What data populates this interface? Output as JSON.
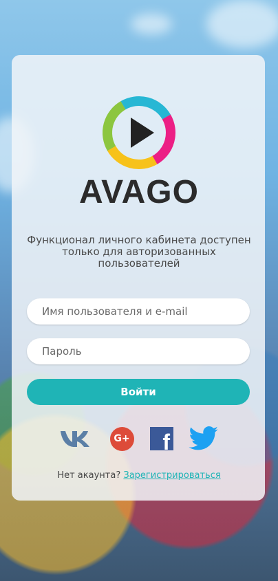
{
  "brand": {
    "name": "AVAGO"
  },
  "info_text": "Функционал личного кабинета доступен только для авторизованных пользователей",
  "form": {
    "username_placeholder": "Имя пользователя и e-mail",
    "password_placeholder": "Пароль",
    "login_label": "Войти"
  },
  "social": {
    "vk_icon": "vk-icon",
    "google_icon": "google-plus-icon",
    "google_text": "G+",
    "facebook_icon": "facebook-icon",
    "facebook_text": "f",
    "twitter_icon": "twitter-icon"
  },
  "register": {
    "prompt": "Нет акаунта?",
    "link_label": "Зарегистрироваться"
  },
  "colors": {
    "accent": "#1fb4b6",
    "vk": "#5b7fa6",
    "google": "#dd4b39",
    "facebook": "#3b5998",
    "twitter": "#1da1f2"
  }
}
